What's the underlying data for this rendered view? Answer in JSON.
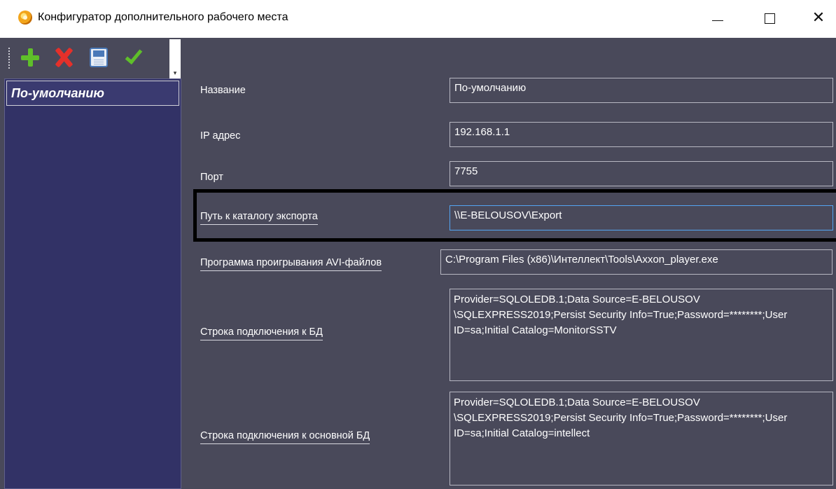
{
  "window": {
    "title": "Конфигуратор дополнительного рабочего места",
    "icon": "app-orange-gear-icon",
    "controls": {
      "minimize": "—",
      "maximize": "☐",
      "close": "✕"
    }
  },
  "toolbar": {
    "buttons": [
      {
        "name": "add",
        "icon": "plus-icon",
        "color": "#5fbf2a"
      },
      {
        "name": "delete",
        "icon": "red-x-icon",
        "color": "#e5302a"
      },
      {
        "name": "save",
        "icon": "floppy-disk-icon",
        "color": "#4a79b8"
      },
      {
        "name": "apply",
        "icon": "checkmark-icon",
        "color": "#5fbf2a"
      }
    ],
    "overflow_glyph": "▾"
  },
  "sidebar": {
    "items": [
      {
        "label": "По-умолчанию",
        "selected": true
      }
    ]
  },
  "form": {
    "fields": [
      {
        "label": "Название",
        "value": "По-умолчанию"
      },
      {
        "label": "IP адрес",
        "value": "192.168.1.1"
      },
      {
        "label": "Порт",
        "value": "7755"
      },
      {
        "label": "Путь к каталогу экспорта",
        "value": "\\\\E-BELOUSOV\\Export"
      },
      {
        "label": "Программа проигрывания AVI-файлов",
        "value": "C:\\Program Files (x86)\\Интеллект\\Tools\\Axxon_player.exe"
      },
      {
        "label": "Строка подключения к БД",
        "value": "Provider=SQLOLEDB.1;Data Source=E-BELOUSOV \\SQLEXPRESS2019;Persist Security Info=True;Password=********;User ID=sa;Initial Catalog=MonitorSSTV"
      },
      {
        "label": "Строка подключения к основной БД",
        "value": "Provider=SQLOLEDB.1;Data Source=E-BELOUSOV \\SQLEXPRESS2019;Persist Security Info=True;Password=********;User ID=sa;Initial Catalog=intellect"
      }
    ]
  },
  "colors": {
    "background": "#49495a",
    "sidebar": "#323266",
    "focus_border": "#53a5f2",
    "highlight_frame": "#000000"
  }
}
